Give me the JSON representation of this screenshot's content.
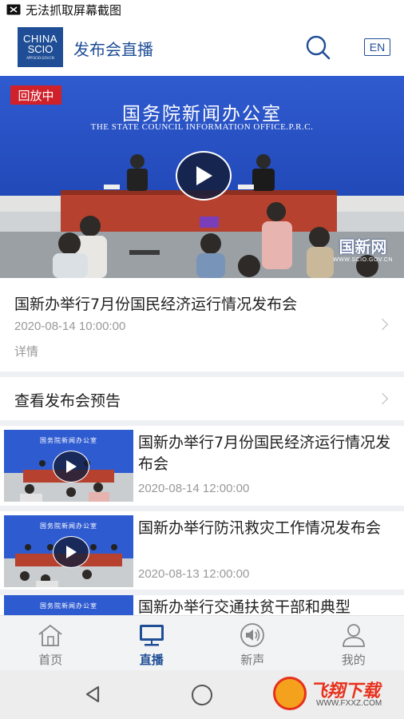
{
  "status_bar": {
    "text": "无法抓取屏幕截图"
  },
  "header": {
    "logo": {
      "line1": "CHINA",
      "line2": "SCIO",
      "line3": "APP.SCIO.GOV.CN"
    },
    "title": "发布会直播",
    "lang_button": "EN"
  },
  "hero": {
    "badge": "回放中",
    "banner_cn": "国务院新闻办公室",
    "banner_en": "THE STATE COUNCIL INFORMATION OFFICE.P.R.C.",
    "watermark_cn": "国新网",
    "watermark_en": "WWW.SCIO.GOV.CN"
  },
  "featured": {
    "title": "国新办举行7月份国民经济运行情况发布会",
    "time": "2020-08-14 10:00:00",
    "detail_label": "详情"
  },
  "preview": {
    "label": "查看发布会预告"
  },
  "list": [
    {
      "title": "国新办举行7月份国民经济运行情况发布会",
      "time": "2020-08-14 12:00:00",
      "thumb_text": "国务院新闻办公室"
    },
    {
      "title": "国新办举行防汛救灾工作情况发布会",
      "time": "2020-08-13 12:00:00",
      "thumb_text": "国务院新闻办公室"
    },
    {
      "title": "国新办举行交通扶贫干部和典型",
      "time": "",
      "thumb_text": "国务院新闻办公室"
    }
  ],
  "tabs": [
    {
      "label": "首页",
      "icon": "home-icon",
      "active": false
    },
    {
      "label": "直播",
      "icon": "monitor-icon",
      "active": true
    },
    {
      "label": "新声",
      "icon": "speaker-icon",
      "active": false
    },
    {
      "label": "我的",
      "icon": "user-icon",
      "active": false
    }
  ],
  "watermark": {
    "cn": "飞翔下载",
    "en": "WWW.FXXZ.COM"
  },
  "colors": {
    "brand": "#1f4e96",
    "badge": "#d0202a",
    "hero_blue": "#2a52c6"
  }
}
